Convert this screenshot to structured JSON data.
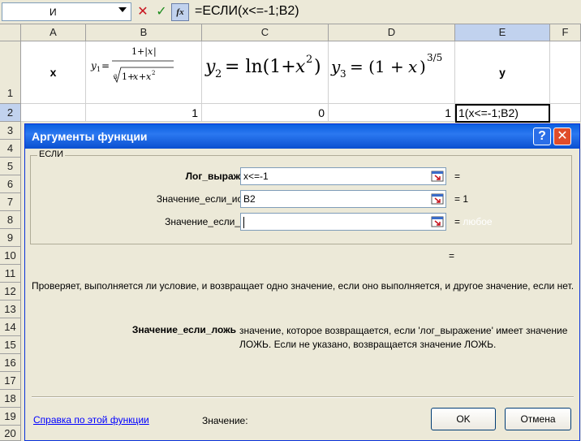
{
  "formula_bar": {
    "name_box": "И",
    "formula": "=ЕСЛИ(x<=-1;B2)"
  },
  "grid": {
    "columns": [
      "A",
      "B",
      "C",
      "D",
      "E",
      "F"
    ],
    "rows": [
      "1",
      "2",
      "3",
      "4",
      "5",
      "6",
      "7",
      "8",
      "9",
      "10",
      "11",
      "12",
      "13",
      "14",
      "15",
      "16",
      "17",
      "18",
      "19",
      "20"
    ],
    "selected_column": "E",
    "selected_row": "2",
    "header_row": {
      "a": "x",
      "e": "y"
    },
    "row2": {
      "b": "1",
      "c": "0",
      "d": "1",
      "e": "1(x<=-1;B2)"
    }
  },
  "dialog": {
    "title": "Аргументы функции",
    "help_btn": "?",
    "close_btn": "✕",
    "group_label": "ЕСЛИ",
    "args": [
      {
        "label": "Лог_выражение",
        "value": "x<=-1",
        "result": "="
      },
      {
        "label": "Значение_если_истина",
        "value": "B2",
        "result": "= 1"
      },
      {
        "label": "Значение_если_ложь",
        "value": "",
        "result": "=",
        "result_extra": "любое"
      }
    ],
    "total_eq": "=",
    "description": "Проверяет, выполняется ли условие, и возвращает одно значение, если оно выполняется, и другое значение, если нет.",
    "help_arg_name": "Значение_если_ложь",
    "help_arg_text": "значение, которое возвращается, если 'лог_выражение' имеет значение ЛОЖЬ. Если не указано, возвращается значение ЛОЖЬ.",
    "help_link": "Справка по этой функции",
    "value_label": "Значение:",
    "ok": "OK",
    "cancel": "Отмена"
  }
}
